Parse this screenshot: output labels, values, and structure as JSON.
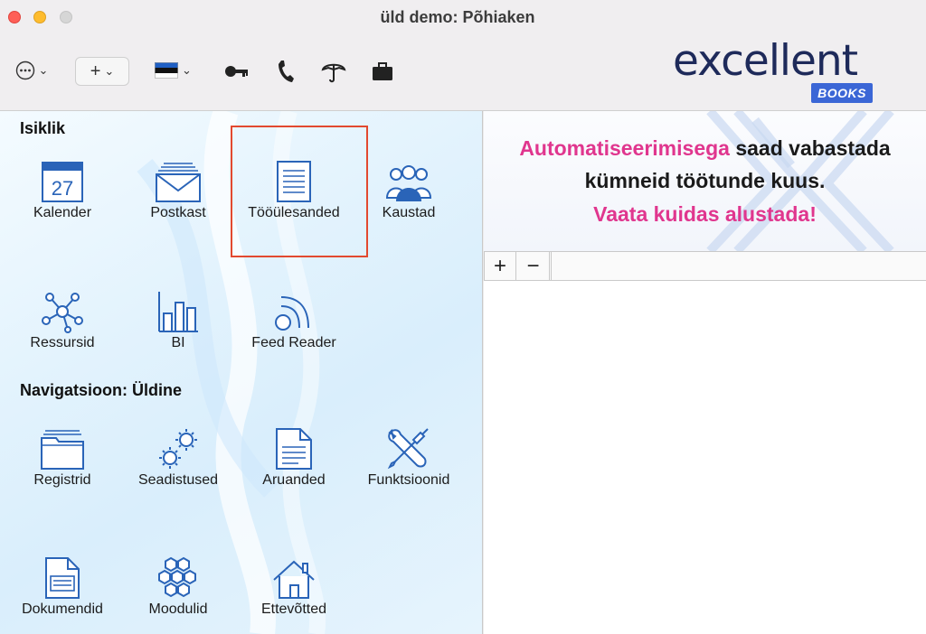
{
  "window": {
    "title": "üld demo: Põhiaken"
  },
  "toolbar": {
    "more_icon": "ellipsis-circle-icon",
    "add_label": "+",
    "language_flag": "estonia-flag-icon",
    "tools": [
      "key-icon",
      "phone-icon",
      "umbrella-icon",
      "briefcase-icon"
    ]
  },
  "logo": {
    "word": "excellent",
    "badge": "BOOKS",
    "color": "#1e2a5a",
    "badge_color": "#3b66d6"
  },
  "sections": {
    "personal_title": "Isiklik",
    "navigation_title": "Navigatsioon: Üldine"
  },
  "personal_items": [
    {
      "label": "Kalender",
      "icon": "calendar-icon",
      "day": "27"
    },
    {
      "label": "Postkast",
      "icon": "mailbox-icon"
    },
    {
      "label": "Tööülesanded",
      "icon": "task-list-icon",
      "highlighted": true
    },
    {
      "label": "Kaustad",
      "icon": "people-group-icon"
    },
    {
      "label": "Ressursid",
      "icon": "resources-network-icon"
    },
    {
      "label": "BI",
      "icon": "bar-chart-icon"
    },
    {
      "label": "Feed Reader",
      "icon": "rss-feed-icon"
    }
  ],
  "navigation_items": [
    {
      "label": "Registrid",
      "icon": "folder-icon"
    },
    {
      "label": "Seadistused",
      "icon": "gears-icon"
    },
    {
      "label": "Aruanded",
      "icon": "report-document-icon"
    },
    {
      "label": "Funktsioonid",
      "icon": "wrench-screwdriver-icon"
    },
    {
      "label": "Dokumendid",
      "icon": "document-icon"
    },
    {
      "label": "Moodulid",
      "icon": "hexagons-icon"
    },
    {
      "label": "Ettevõtted",
      "icon": "house-icon"
    }
  ],
  "banner": {
    "line1_highlight": "Automatiseerimisega",
    "line1_rest": " saad vabastada",
    "line2": "kümneid töötunde kuus.",
    "line3": "Vaata kuidas alustada!",
    "accent_color": "#e0368e"
  },
  "list_toolbar": {
    "add": "+",
    "remove": "−"
  },
  "colors": {
    "icon_blue": "#2a64b8",
    "highlight_border": "#e2492f"
  }
}
